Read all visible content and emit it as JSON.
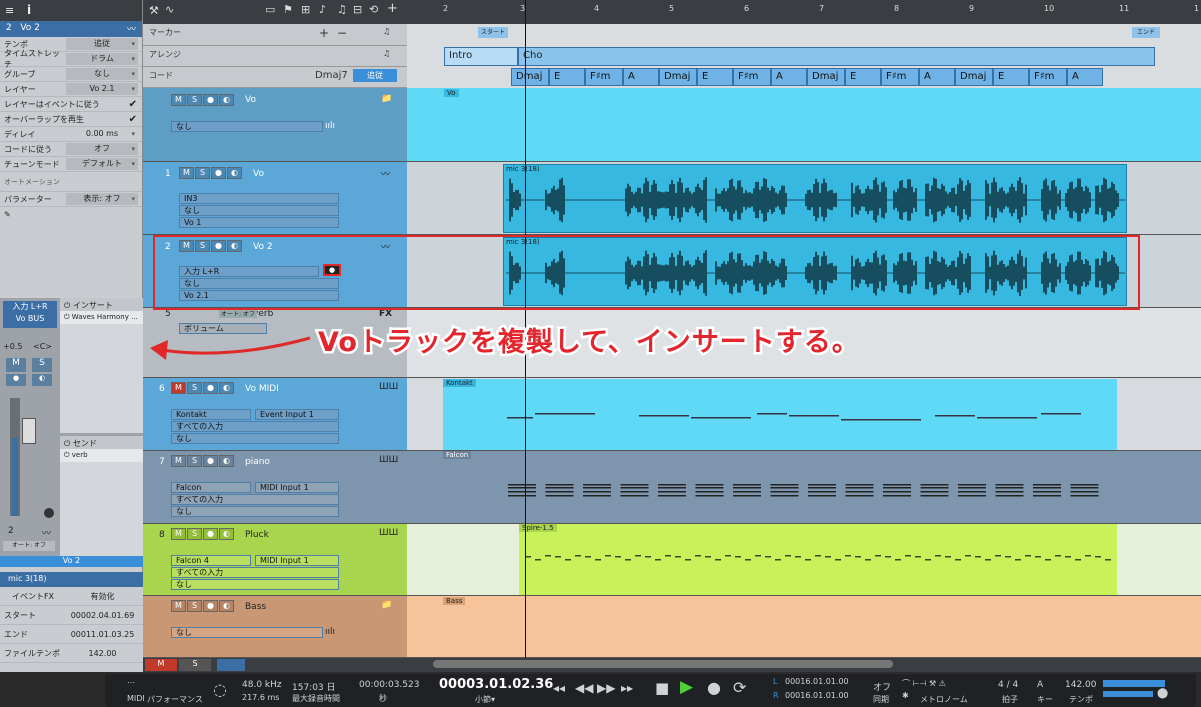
{
  "inspector": {
    "track_number": "2",
    "track_name": "Vo 2",
    "rows": [
      {
        "label": "テンポ",
        "value": "追従"
      },
      {
        "label": "タイムストレッチ",
        "value": "ドラム"
      },
      {
        "label": "グルーブ",
        "value": "なし"
      },
      {
        "label": "レイヤー",
        "value": "Vo 2.1"
      }
    ],
    "check_rows": [
      "レイヤーはイベントに従う",
      "オーバーラップを再生"
    ],
    "rows2": [
      {
        "label": "ディレイ",
        "value": "0.00 ms"
      },
      {
        "label": "コードに従う",
        "value": "オフ"
      },
      {
        "label": "チューンモード",
        "value": "デフォルト"
      }
    ],
    "automation_label": "オートメーション",
    "param_label": "パラメーター",
    "param_value": "表示: オフ",
    "channel": {
      "input": "入力 L+R",
      "bus": "Vo BUS",
      "pan": "+0.5",
      "pan_mode": "<C>",
      "number": "2",
      "auto": "オート: オフ",
      "footer": "Vo 2"
    },
    "insert_label": "インサート",
    "insert_item": "Waves Harmony ...",
    "send_label": "センド",
    "send_item": "verb",
    "event_title": "mic 3(18)",
    "event_rows": [
      {
        "label": "イベントFX",
        "value": "有効化"
      },
      {
        "label": "スタート",
        "value": "00002.04.01.69"
      },
      {
        "label": "エンド",
        "value": "00011.01.03.25"
      },
      {
        "label": "ファイルテンポ",
        "value": "142.00"
      }
    ]
  },
  "global_tracks": {
    "marker": "マーカー",
    "arrange": "アレンジ",
    "chord": "コード",
    "chord_value": "Dmaj7",
    "chord_follow": "追従"
  },
  "ruler": {
    "bars": [
      "2",
      "3",
      "4",
      "5",
      "6",
      "7",
      "8",
      "9",
      "10",
      "11",
      "1"
    ]
  },
  "markers": {
    "start": "スタート",
    "end": "エンド"
  },
  "arrangement": {
    "intro": "Intro",
    "cho": "Cho"
  },
  "chords": [
    "Dmaj",
    "E",
    "F♯m",
    "A",
    "Dmaj",
    "E",
    "F♯m",
    "A",
    "Dmaj",
    "E",
    "F♯m",
    "A",
    "Dmaj",
    "E",
    "F♯m",
    "A"
  ],
  "tracks": [
    {
      "num": "",
      "name": "Vo",
      "sub1": "なし",
      "lane_label": "Vo"
    },
    {
      "num": "1",
      "name": "Vo",
      "sub1": "IN3",
      "sub2": "なし",
      "sub3": "Vo 1",
      "lane_label": "mic 3(18)"
    },
    {
      "num": "2",
      "name": "Vo 2",
      "sub1": "入力 L+R",
      "sub2": "なし",
      "sub3": "Vo 2.1",
      "lane_label": "mic 3(18)"
    },
    {
      "num": "5",
      "name": "verb",
      "sub1": "ボリューム",
      "fx": "FX",
      "auto": "オート: オフ"
    },
    {
      "num": "6",
      "name": "Vo MIDI",
      "sub1": "Kontakt",
      "sub1b": "Event Input 1",
      "sub2": "すべての入力",
      "sub3": "なし",
      "lane_label": "Kontakt"
    },
    {
      "num": "7",
      "name": "piano",
      "sub1": "Falcon",
      "sub1b": "MIDI Input 1",
      "sub2": "すべての入力",
      "sub3": "なし",
      "lane_label": "Falcon"
    },
    {
      "num": "8",
      "name": "Pluck",
      "sub1": "Falcon 4",
      "sub1b": "MIDI Input 1",
      "sub2": "すべての入力",
      "sub3": "なし",
      "lane_label": "Spire-1.5"
    },
    {
      "num": "",
      "name": "Bass",
      "sub1": "なし",
      "lane_label": "Bass"
    }
  ],
  "annotation": "Voトラックを複製して、インサートする。",
  "transport": {
    "midi": "MIDI",
    "perf": "パフォーマンス",
    "khz": "48.0 kHz",
    "ms": "217.6 ms",
    "days": "157:03 日",
    "max_rec": "最大録音時間",
    "time": "00:00:03.523",
    "sec": "秒",
    "position": "00003.01.02.36",
    "bar_label": "小節▾",
    "L": "00016.01.01.00",
    "R": "00016.01.01.00",
    "off": "オフ",
    "sync": "同期",
    "metronome": "メトロノーム",
    "sig": "4 / 4",
    "sig_label": "拍子",
    "key": "A",
    "key_label": "キー",
    "tempo": "142.00",
    "tempo_label": "テンポ"
  },
  "colors": {
    "vo": "#5fd9f5",
    "vo_dark": "#36b8e0",
    "falcon": "#7d96ae",
    "pluck": "#c9f25a",
    "bass": "#f6c39a",
    "select": "#e02828",
    "annotation": "#e3262d"
  }
}
